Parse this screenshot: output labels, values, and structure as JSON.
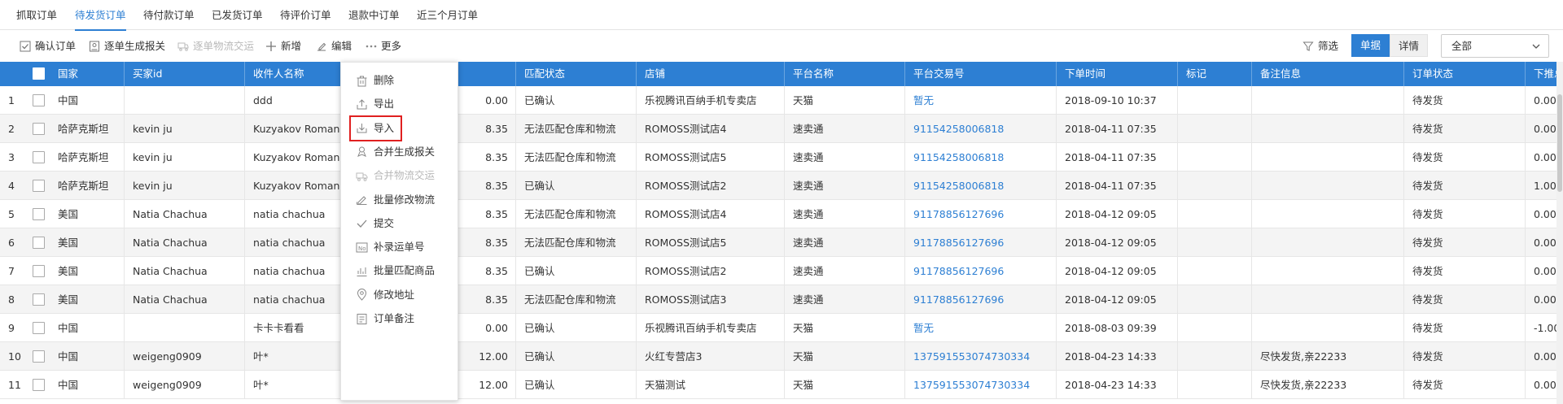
{
  "tabs": [
    {
      "label": "抓取订单",
      "active": false
    },
    {
      "label": "待发货订单",
      "active": true
    },
    {
      "label": "待付款订单",
      "active": false
    },
    {
      "label": "已发货订单",
      "active": false
    },
    {
      "label": "待评价订单",
      "active": false
    },
    {
      "label": "退款中订单",
      "active": false
    },
    {
      "label": "近三个月订单",
      "active": false
    }
  ],
  "toolbar": {
    "confirm": "确认订单",
    "declare": "逐单生成报关",
    "deliver": "逐单物流交运",
    "add": "新增",
    "edit": "编辑",
    "more": "更多",
    "filter": "筛选",
    "view_list": "单据",
    "view_detail": "详情",
    "select_value": "全部"
  },
  "columns": [
    "国家",
    "买家id",
    "收件人名称",
    "",
    "匹配状态",
    "店铺",
    "平台名称",
    "平台交易号",
    "下单时间",
    "标记",
    "备注信息",
    "订单状态",
    "下推总"
  ],
  "rows": [
    [
      "1",
      "中国",
      "",
      "ddd",
      "0.00",
      "已确认",
      "乐视腾讯百纳手机专卖店",
      "天猫",
      "暂无",
      "2018-09-10 10:37",
      "",
      "",
      "待发货",
      "0.00"
    ],
    [
      "2",
      "哈萨克斯坦",
      "kevin ju",
      "Kuzyakov Roman",
      "8.35",
      "无法匹配仓库和物流",
      "ROMOSS测试店4",
      "速卖通",
      "91154258006818",
      "2018-04-11 07:35",
      "",
      "",
      "待发货",
      "0.00"
    ],
    [
      "3",
      "哈萨克斯坦",
      "kevin ju",
      "Kuzyakov Roman",
      "8.35",
      "无法匹配仓库和物流",
      "ROMOSS测试店5",
      "速卖通",
      "91154258006818",
      "2018-04-11 07:35",
      "",
      "",
      "待发货",
      "0.00"
    ],
    [
      "4",
      "哈萨克斯坦",
      "kevin ju",
      "Kuzyakov Roman",
      "8.35",
      "已确认",
      "ROMOSS测试店2",
      "速卖通",
      "91154258006818",
      "2018-04-11 07:35",
      "",
      "",
      "待发货",
      "1.00"
    ],
    [
      "5",
      "美国",
      "Natia Chachua",
      "natia chachua",
      "8.35",
      "无法匹配仓库和物流",
      "ROMOSS测试店4",
      "速卖通",
      "91178856127696",
      "2018-04-12 09:05",
      "",
      "",
      "待发货",
      "0.00"
    ],
    [
      "6",
      "美国",
      "Natia Chachua",
      "natia chachua",
      "8.35",
      "无法匹配仓库和物流",
      "ROMOSS测试店5",
      "速卖通",
      "91178856127696",
      "2018-04-12 09:05",
      "",
      "",
      "待发货",
      "0.00"
    ],
    [
      "7",
      "美国",
      "Natia Chachua",
      "natia chachua",
      "8.35",
      "已确认",
      "ROMOSS测试店2",
      "速卖通",
      "91178856127696",
      "2018-04-12 09:05",
      "",
      "",
      "待发货",
      "0.00"
    ],
    [
      "8",
      "美国",
      "Natia Chachua",
      "natia chachua",
      "8.35",
      "无法匹配仓库和物流",
      "ROMOSS测试店3",
      "速卖通",
      "91178856127696",
      "2018-04-12 09:05",
      "",
      "",
      "待发货",
      "0.00"
    ],
    [
      "9",
      "中国",
      "",
      "卡卡卡看看",
      "0.00",
      "已确认",
      "乐视腾讯百纳手机专卖店",
      "天猫",
      "暂无",
      "2018-08-03 09:39",
      "",
      "",
      "待发货",
      "-1.00"
    ],
    [
      "10",
      "中国",
      "weigeng0909",
      "叶*",
      "12.00",
      "已确认",
      "火红专营店3",
      "天猫",
      "137591553074730334",
      "2018-04-23 14:33",
      "",
      "尽快发货,亲22233",
      "待发货",
      "0.00"
    ],
    [
      "11",
      "中国",
      "weigeng0909",
      "叶*",
      "12.00",
      "已确认",
      "天猫测试",
      "天猫",
      "137591553074730334",
      "2018-04-23 14:33",
      "",
      "尽快发货,亲22233",
      "待发货",
      "0.00"
    ]
  ],
  "menu": [
    {
      "label": "删除",
      "icon": "trash-icon",
      "disabled": false
    },
    {
      "label": "导出",
      "icon": "export-icon",
      "disabled": false
    },
    {
      "label": "导入",
      "icon": "import-icon",
      "disabled": false,
      "highlighted": true
    },
    {
      "label": "合并生成报关",
      "icon": "merge-declare-icon",
      "disabled": false
    },
    {
      "label": "合并物流交运",
      "icon": "truck-icon",
      "disabled": true
    },
    {
      "label": "批量修改物流",
      "icon": "batch-edit-icon",
      "disabled": false
    },
    {
      "label": "提交",
      "icon": "check-icon",
      "disabled": false
    },
    {
      "label": "补录运单号",
      "icon": "waybill-no-icon",
      "disabled": false
    },
    {
      "label": "批量匹配商品",
      "icon": "match-goods-icon",
      "disabled": false
    },
    {
      "label": "修改地址",
      "icon": "location-icon",
      "disabled": false
    },
    {
      "label": "订单备注",
      "icon": "note-icon",
      "disabled": false
    }
  ],
  "colors": {
    "accent": "#2d7fd3",
    "highlight": "#e02020"
  }
}
